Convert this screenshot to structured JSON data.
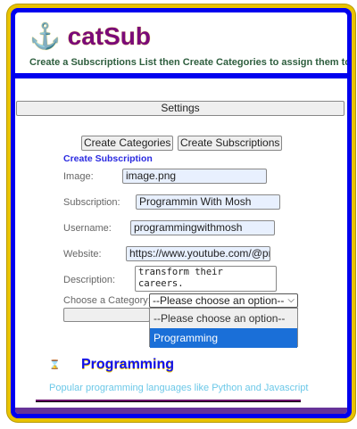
{
  "header": {
    "logo_icon": "anchor-icon",
    "logo_text": "⚓ catSub",
    "tagline": "Create a Subscriptions List then Create Categories to assign them to"
  },
  "settings_label": "Settings",
  "buttons": {
    "create_categories": "Create Categories",
    "create_subscriptions": "Create Subscriptions"
  },
  "form": {
    "title": "Create Subscription",
    "image_label": "Image:",
    "image_value": "image.png",
    "subscription_label": "Subscription:",
    "subscription_value": "Programmin With Mosh",
    "username_label": "Username:",
    "username_value": "programmingwithmosh",
    "website_label": "Website:",
    "website_value": "https://www.youtube.com/@pr",
    "description_label": "Description:",
    "description_value": "transform their careers.",
    "category_label": "Choose a Category:",
    "category_value": "--Please choose an option--",
    "category_options": [
      "--Please choose an option--",
      "Programming"
    ]
  },
  "category": {
    "icon": "hourglass-icon",
    "title": "Programming",
    "description": "Popular programming languages like Python and Javascript"
  },
  "colors": {
    "frame": "#e8c200",
    "border": "#0000ee",
    "logo": "#7a0a7a",
    "highlight": "#1a6fd8"
  }
}
